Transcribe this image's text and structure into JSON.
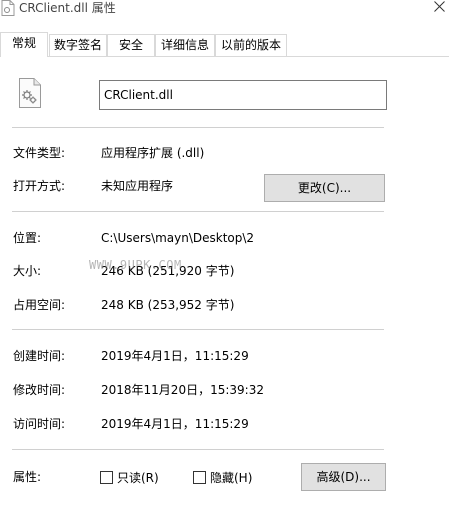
{
  "window": {
    "title": "CRClient.dll 属性"
  },
  "tabs": [
    {
      "label": "常规",
      "active": true
    },
    {
      "label": "数字签名",
      "active": false
    },
    {
      "label": "安全",
      "active": false
    },
    {
      "label": "详细信息",
      "active": false
    },
    {
      "label": "以前的版本",
      "active": false
    }
  ],
  "general": {
    "filename": "CRClient.dll",
    "file_type": {
      "label": "文件类型:",
      "value": "应用程序扩展 (.dll)"
    },
    "open_with": {
      "label": "打开方式:",
      "value": "未知应用程序",
      "button": "更改(C)..."
    },
    "location": {
      "label": "位置:",
      "value": "C:\\Users\\mayn\\Desktop\\2"
    },
    "size": {
      "label": "大小:",
      "value": "246 KB (251,920 字节)"
    },
    "size_on_disk": {
      "label": "占用空间:",
      "value": "248 KB (253,952 字节)"
    },
    "created": {
      "label": "创建时间:",
      "value": "2019年4月1日，11:15:29"
    },
    "modified": {
      "label": "修改时间:",
      "value": "2018年11月20日，15:39:32"
    },
    "accessed": {
      "label": "访问时间:",
      "value": "2019年4月1日，11:15:29"
    },
    "attributes": {
      "label": "属性:",
      "readonly": {
        "label": "只读(R)",
        "checked": false
      },
      "hidden": {
        "label": "隐藏(H)",
        "checked": false
      },
      "advanced_button": "高级(D)..."
    }
  },
  "watermark": "WWW.9UPK.COM"
}
